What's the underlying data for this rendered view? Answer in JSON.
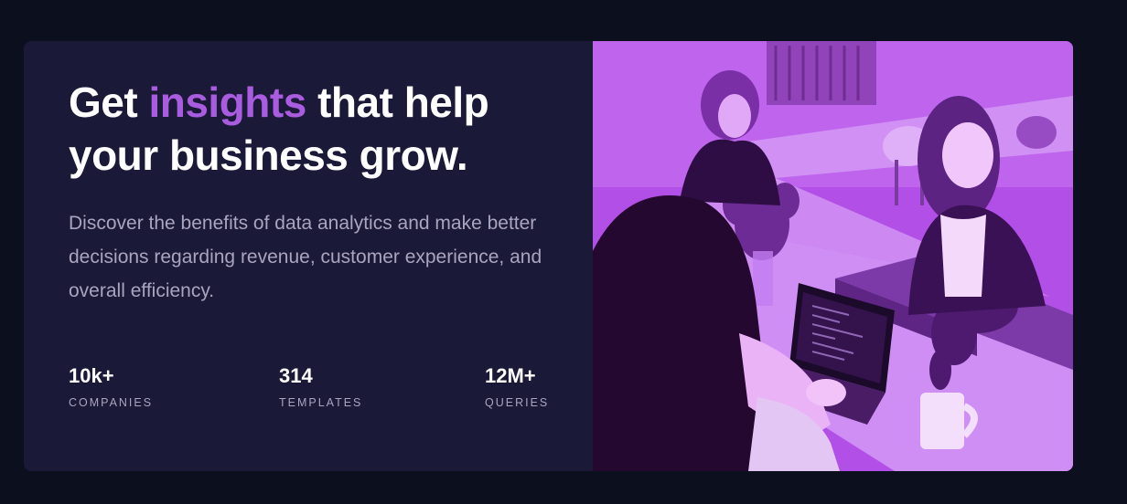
{
  "headline": {
    "part1": "Get ",
    "accent": "insights",
    "part2": " that help your business grow."
  },
  "description": "Discover the benefits of data analytics and make better decisions regarding revenue, customer experience, and overall efficiency.",
  "stats": [
    {
      "value": "10k+",
      "label": "COMPANIES"
    },
    {
      "value": "314",
      "label": "TEMPLATES"
    },
    {
      "value": "12M+",
      "label": "QUERIES"
    }
  ],
  "colors": {
    "page_background": "#0b0f1e",
    "card_background": "#1b1938",
    "accent": "#a95ce0",
    "photo_tint": "#b04de8"
  },
  "image": {
    "subject": "photo-office-meeting"
  }
}
